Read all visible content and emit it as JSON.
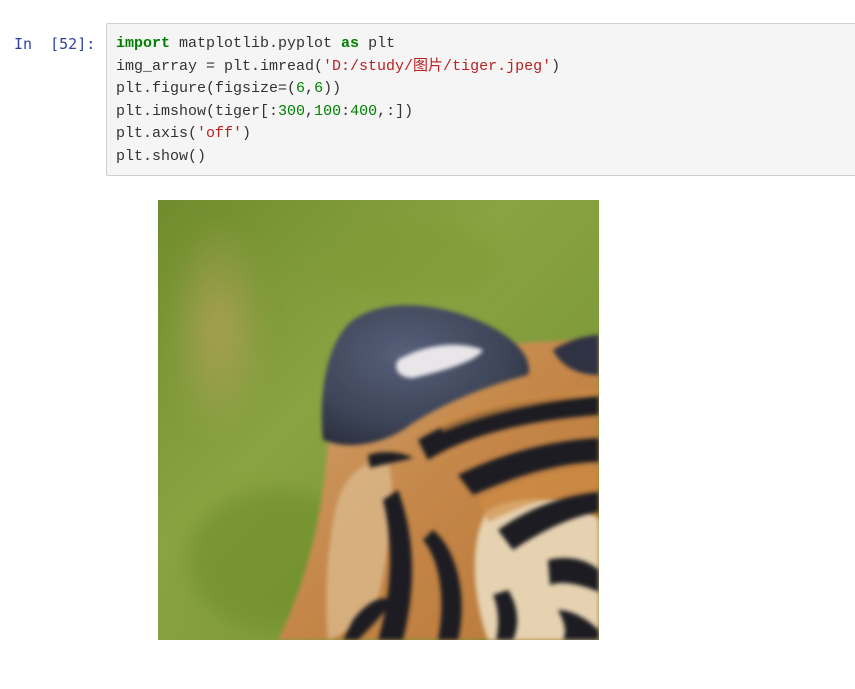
{
  "cell": {
    "prompt": "In  [52]:",
    "code": {
      "line1": {
        "kw1": "import",
        "mod": " matplotlib.pyplot ",
        "kw2": "as",
        "alias": " plt"
      },
      "line2": {
        "pre": "img_array = plt.imread(",
        "str": "'D:/study/图片/tiger.jpeg'",
        "post": ")"
      },
      "line3": {
        "pre": "plt.figure(figsize=(",
        "n1": "6",
        "comma": ",",
        "n2": "6",
        "post": "))"
      },
      "line4": {
        "pre": "plt.imshow(tiger[:",
        "n1": "300",
        "comma": ",",
        "n2": "100",
        "colon": ":",
        "n3": "400",
        "post": ",:])"
      },
      "line5": {
        "pre": "plt.axis(",
        "str": "'off'",
        "post": ")"
      },
      "line6": {
        "pre": "plt.show()"
      }
    }
  },
  "output": {
    "image_content": "tiger-ear-crop",
    "colors": {
      "background_green": "#7f9a3a",
      "ear_dark": "#3e4556",
      "fur_orange": "#c48a4e",
      "fur_cream": "#e8d5b5",
      "stripe_black": "#1b1b1f"
    }
  }
}
